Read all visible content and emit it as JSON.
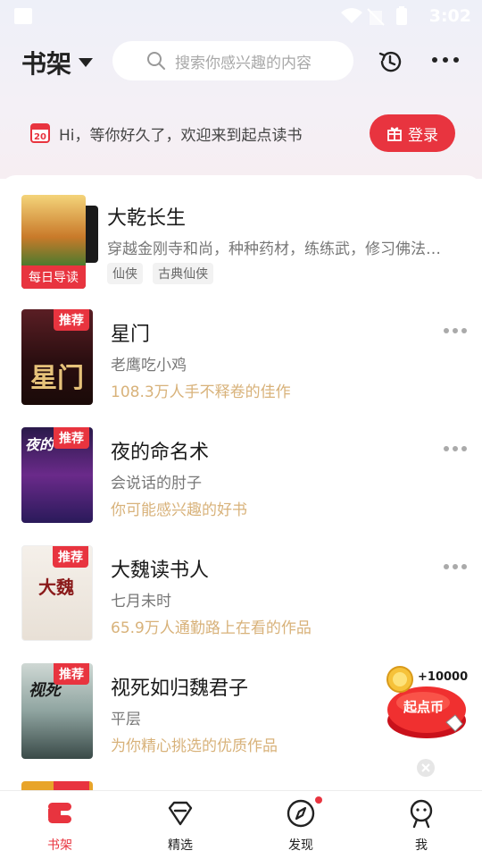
{
  "status": {
    "time": "3:02"
  },
  "header": {
    "shelf_label": "书架",
    "search_placeholder": "搜索你感兴趣的内容"
  },
  "welcome": {
    "calendar_day": "20",
    "message": "Hi，等你好久了，欢迎来到起点读书",
    "login_label": "登录"
  },
  "featured": {
    "title": "大乾长生",
    "desc": "穿越金刚寺和尚，种种药材，练练武，修习佛法…",
    "tags": [
      "仙侠",
      "古典仙侠"
    ],
    "badge": "每日导读"
  },
  "books": [
    {
      "badge": "推荐",
      "title": "星门",
      "author": "老鹰吃小鸡",
      "reason": "108.3万人手不释卷的佳作",
      "cover_text": "星门"
    },
    {
      "badge": "推荐",
      "title": "夜的命名术",
      "author": "会说话的肘子",
      "reason": "你可能感兴趣的好书",
      "cover_text": "夜的"
    },
    {
      "badge": "推荐",
      "title": "大魏读书人",
      "author": "七月未时",
      "reason": "65.9万人通勤路上在看的作品",
      "cover_text": "大魏"
    },
    {
      "badge": "推荐",
      "title": "视死如归魏君子",
      "author": "平层",
      "reason": "为你精心挑选的优质作品",
      "cover_text": "视死"
    }
  ],
  "promo": {
    "amount": "+10000",
    "label": "起点币"
  },
  "tabs": [
    {
      "label": "书架"
    },
    {
      "label": "精选"
    },
    {
      "label": "发现"
    },
    {
      "label": "我"
    }
  ],
  "colors": {
    "accent": "#e8343f",
    "reason": "#d8b27a"
  }
}
